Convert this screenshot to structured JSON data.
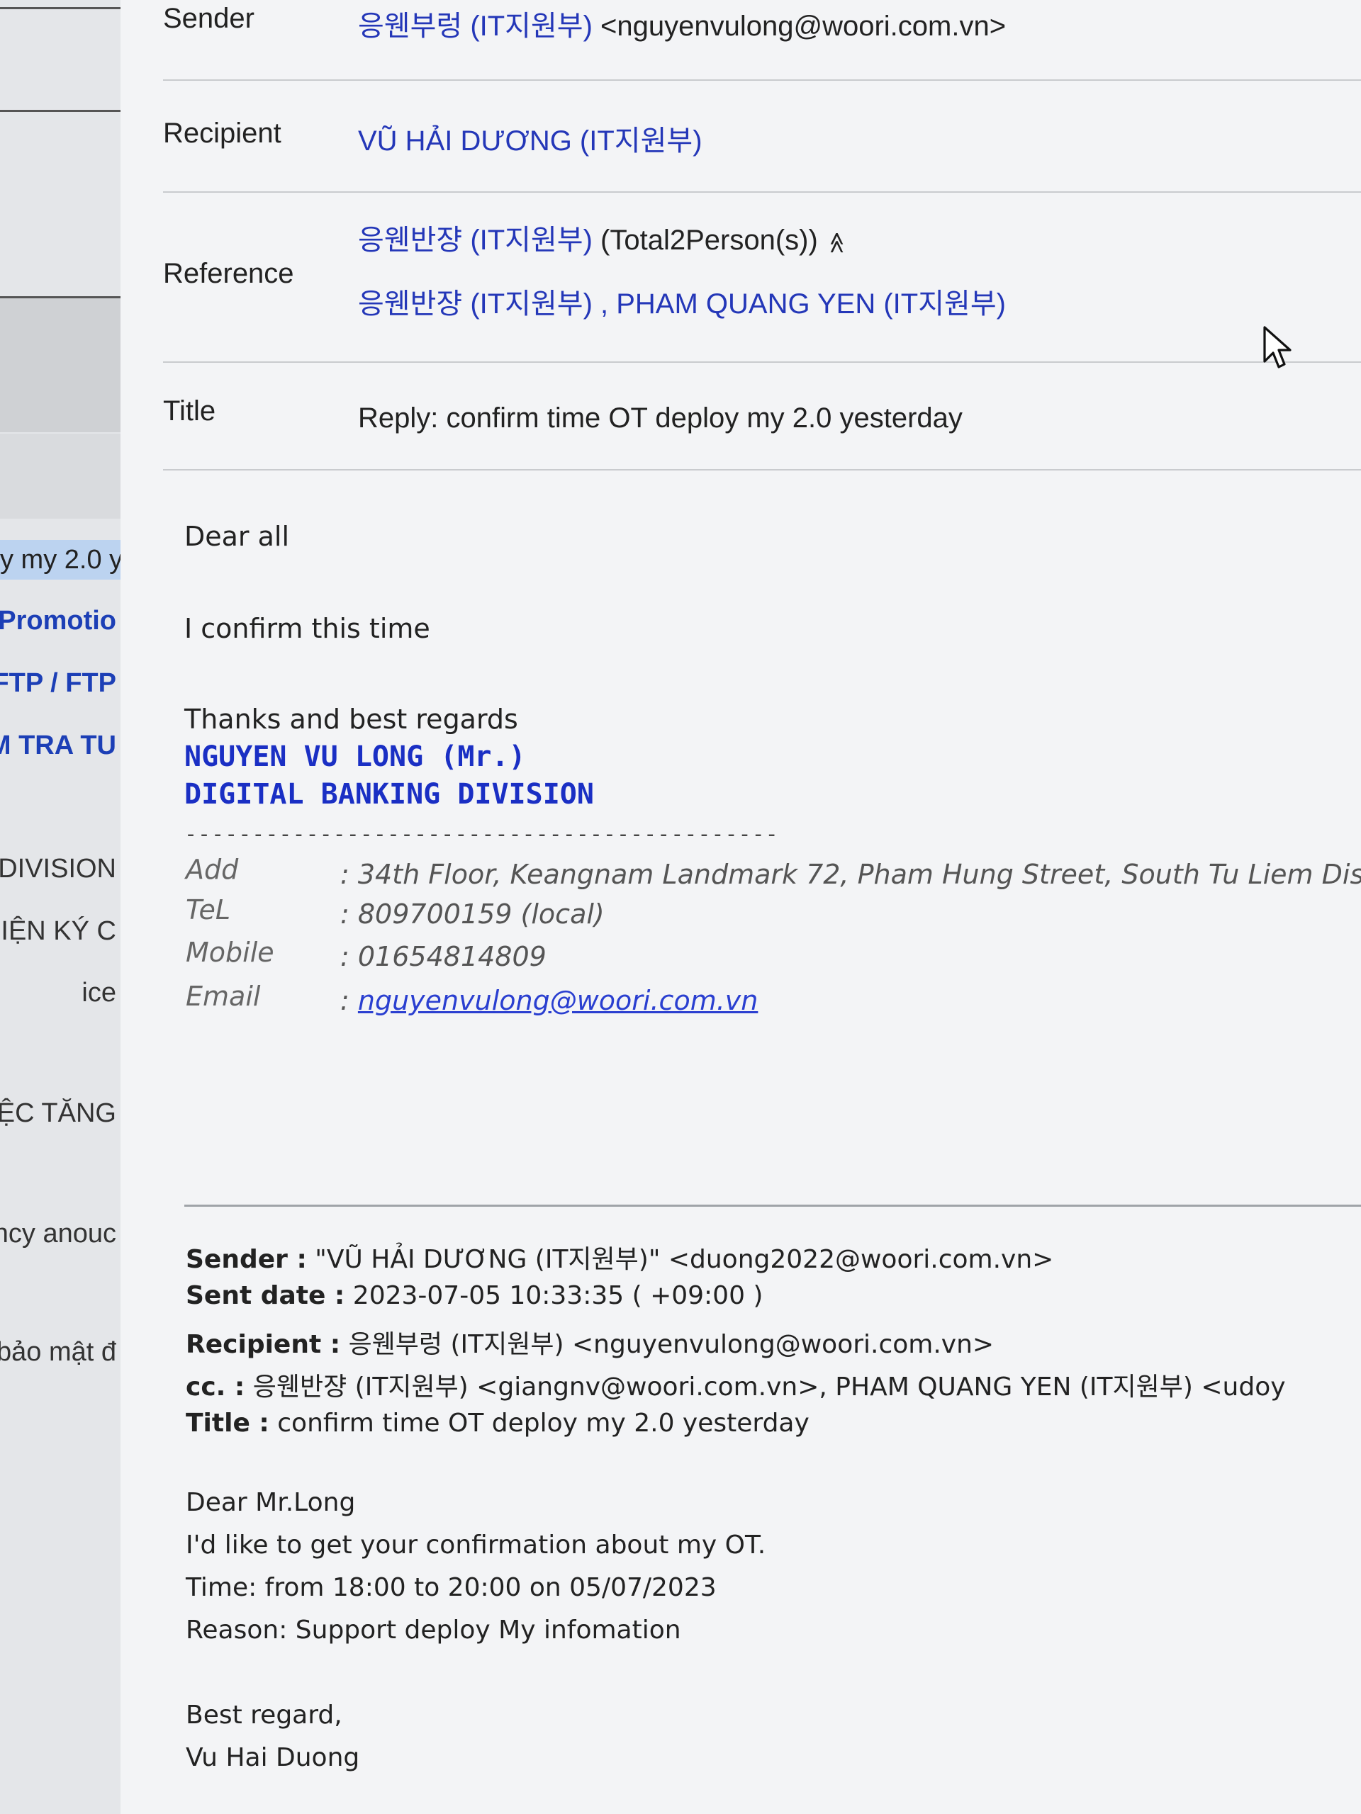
{
  "list": {
    "items": [
      {
        "text": "y my 2.0 y",
        "style": "sel"
      },
      {
        "text": "Promotio",
        "style": "blue"
      },
      {
        "text": "FTP / FTP",
        "style": "blue"
      },
      {
        "text": "M TRA TU",
        "style": "blue"
      },
      {
        "text": "G DIVISION",
        "style": "dark"
      },
      {
        "text": "HIỆN KÝ C",
        "style": "dark"
      },
      {
        "text": "ice",
        "style": "dark"
      },
      {
        "text": "IỆC TĂNG",
        "style": "dark"
      },
      {
        "text": "ency anouc",
        "style": "dark"
      },
      {
        "text": "bảo mật đ",
        "style": "dark"
      }
    ]
  },
  "header": {
    "sender_label": "Sender",
    "sender_name": "응웬부렁 (IT지원부)",
    "sender_addr": "<nguyenvulong@woori.com.vn>",
    "recipient_label": "Recipient",
    "recipient_value": "VŨ HẢI DƯƠNG (IT지원부)",
    "reference_label": "Reference",
    "reference_summary": "응웬반쟝 (IT지원부)",
    "reference_total": "(Total2Person(s))",
    "reference_toggle": "≫",
    "reference_list": "응웬반쟝 (IT지원부) , PHAM QUANG YEN (IT지원부)",
    "title_label": "Title",
    "title_value": "Reply: confirm time OT deploy my 2.0 yesterday"
  },
  "body": {
    "greeting": "Dear all",
    "line1": "I confirm this time",
    "closing": "Thanks and best regards",
    "sig_name": "NGUYEN VU LONG (Mr.)",
    "sig_division": "DIGITAL BANKING DIVISION",
    "dashes": "--------------------------------------------",
    "add_label": "Add",
    "add_value": ": 34th Floor, Keangnam Landmark 72, Pham Hung Street, South Tu Liem Dis",
    "tel_label": "TeL",
    "tel_value": ": 809700159 (local)",
    "mobile_label": "Mobile",
    "mobile_value": ": 01654814809",
    "email_label": "Email",
    "email_prefix": ": ",
    "email_value": "nguyenvulong@woori.com.vn"
  },
  "quoted": {
    "sender_label": "Sender :",
    "sender_value": "\"VŨ HẢI DƯƠNG (IT지원부)\" <duong2022@woori.com.vn>",
    "sent_label": "Sent date :",
    "sent_value": "2023-07-05 10:33:35 ( +09:00 )",
    "recipient_label": "Recipient :",
    "recipient_value": "응웬부렁 (IT지원부) <nguyenvulong@woori.com.vn>",
    "cc_label": "cc. :",
    "cc_value": "응웬반쟝 (IT지원부) <giangnv@woori.com.vn>, PHAM QUANG YEN (IT지원부) <udoy",
    "title_label": "Title :",
    "title_value": "confirm time OT deploy my 2.0 yesterday",
    "lines": [
      "Dear Mr.Long",
      "I'd like to get your confirmation about my OT.",
      "Time: from 18:00 to 20:00 on 05/07/2023",
      "Reason: Support deploy My infomation",
      "",
      "Best regard,",
      "Vu Hai Duong"
    ]
  }
}
